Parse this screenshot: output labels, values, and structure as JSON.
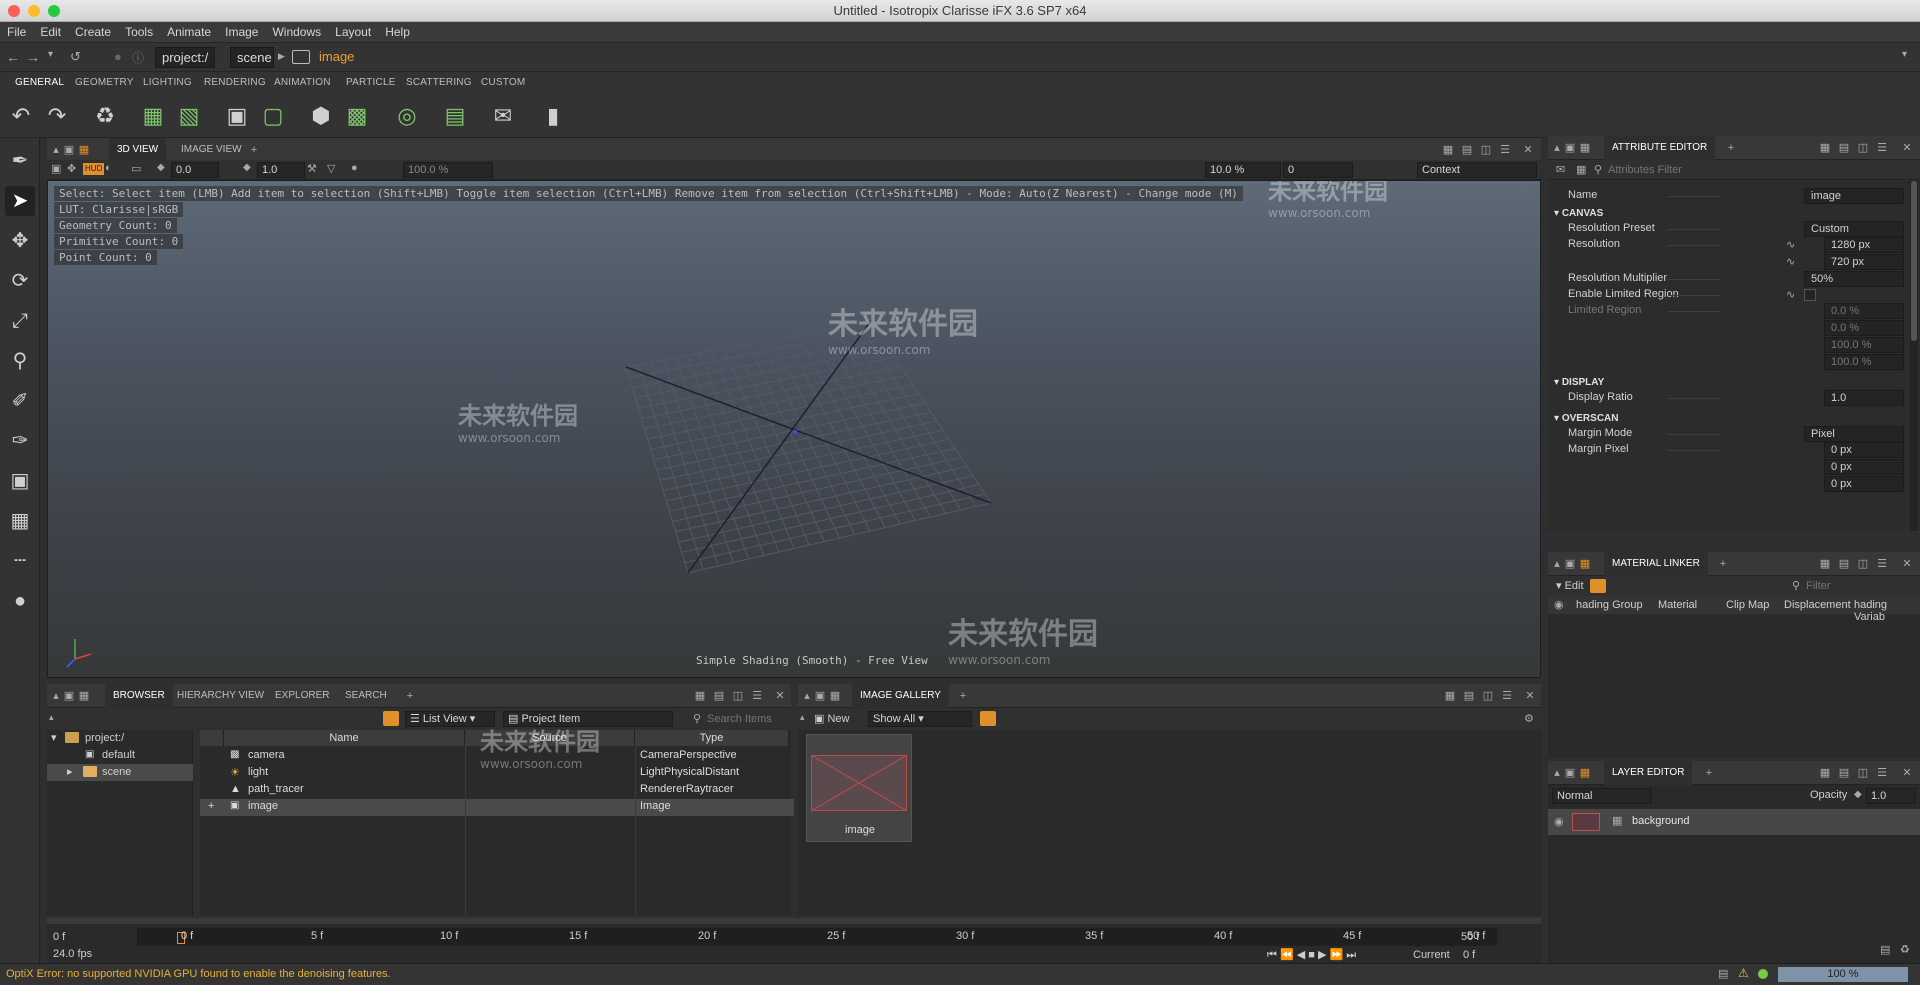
{
  "window": {
    "title": "Untitled - Isotropix Clarisse iFX 3.6 SP7 x64"
  },
  "menu": [
    "File",
    "Edit",
    "Create",
    "Tools",
    "Animate",
    "Image",
    "Windows",
    "Layout",
    "Help"
  ],
  "address": {
    "root": "project:/",
    "scene": "scene",
    "item": "image"
  },
  "shelf_tabs": [
    "GENERAL",
    "GEOMETRY",
    "LIGHTING",
    "RENDERING",
    "ANIMATION",
    "PARTICLE",
    "SCATTERING",
    "CUSTOM"
  ],
  "view_tabs": [
    "3D VIEW",
    "IMAGE VIEW"
  ],
  "viewport": {
    "toolbar": {
      "v1": "0.0",
      "v2": "1.0",
      "zoom": "100.0 %",
      "zoom2": "10.0 %",
      "frame": "0",
      "context": "Context"
    },
    "info": [
      "Select: Select item (LMB)  Add item to selection (Shift+LMB)  Toggle item selection (Ctrl+LMB)  Remove item from selection (Ctrl+Shift+LMB)  - Mode: Auto(Z Nearest) - Change mode (M)",
      "LUT: Clarisse|sRGB",
      "Geometry Count: 0",
      "Primitive Count: 0",
      "Point Count: 0"
    ],
    "footer": "Simple Shading (Smooth) - Free View"
  },
  "attribute_editor": {
    "title": "ATTRIBUTE EDITOR",
    "filter_placeholder": "Attributes Filter",
    "name_label": "Name",
    "name_value": "image",
    "sections": {
      "canvas": "CANVAS",
      "display": "DISPLAY",
      "overscan": "OVERSCAN"
    },
    "rows": {
      "res_preset": {
        "label": "Resolution Preset",
        "value": "Custom"
      },
      "resolution": {
        "label": "Resolution",
        "w": "1280 px",
        "h": "720 px"
      },
      "res_mult": {
        "label": "Resolution Multiplier",
        "value": "50%"
      },
      "limited": {
        "label": "Enable Limited Region"
      },
      "limited_region": {
        "label": "Limited Region",
        "v1": "0.0 %",
        "v2": "0.0 %",
        "v3": "100.0 %",
        "v4": "100.0 %"
      },
      "display_ratio": {
        "label": "Display Ratio",
        "value": "1.0"
      },
      "margin_mode": {
        "label": "Margin Mode",
        "value": "Pixel"
      },
      "margin_pixel": {
        "label": "Margin Pixel",
        "v1": "0 px",
        "v2": "0 px",
        "v3": "0 px"
      }
    }
  },
  "material_linker": {
    "title": "MATERIAL LINKER",
    "edit": "Edit",
    "filter_placeholder": "Filter",
    "columns": [
      "hading Group",
      "Material",
      "Clip Map",
      "Displacement",
      "hading Variab"
    ]
  },
  "layer_editor": {
    "title": "LAYER EDITOR",
    "blend": "Normal",
    "opacity_label": "Opacity",
    "opacity": "1.0",
    "layer": "background"
  },
  "browser": {
    "tabs": [
      "BROWSER",
      "HIERARCHY VIEW",
      "EXPLORER",
      "SEARCH"
    ],
    "view_mode": "List View",
    "filter": "Project Item",
    "search_placeholder": "Search Items",
    "tree": [
      "project:/",
      "default",
      "scene"
    ],
    "columns": [
      "Name",
      "Source",
      "Type"
    ],
    "rows": [
      {
        "name": "camera",
        "type": "CameraPerspective"
      },
      {
        "name": "light",
        "type": "LightPhysicalDistant"
      },
      {
        "name": "path_tracer",
        "type": "RendererRaytracer"
      },
      {
        "name": "image",
        "type": "Image"
      }
    ]
  },
  "gallery": {
    "title": "IMAGE GALLERY",
    "new": "New",
    "filter": "Show All",
    "thumb_label": "image"
  },
  "timeline": {
    "start": "0 f",
    "fps": "24.0 fps",
    "ticks": [
      "0 f",
      "5 f",
      "10 f",
      "15 f",
      "20 f",
      "25 f",
      "30 f",
      "35 f",
      "40 f",
      "45 f",
      "50 f"
    ],
    "end": "50 f",
    "current_label": "Current",
    "current": "0 f"
  },
  "status": {
    "error": "OptiX Error: no supported NVIDIA GPU found to enable the denoising features.",
    "progress": "100 %"
  },
  "watermarks": {
    "brand": "未来软件园",
    "url": "www.orsoon.com"
  }
}
